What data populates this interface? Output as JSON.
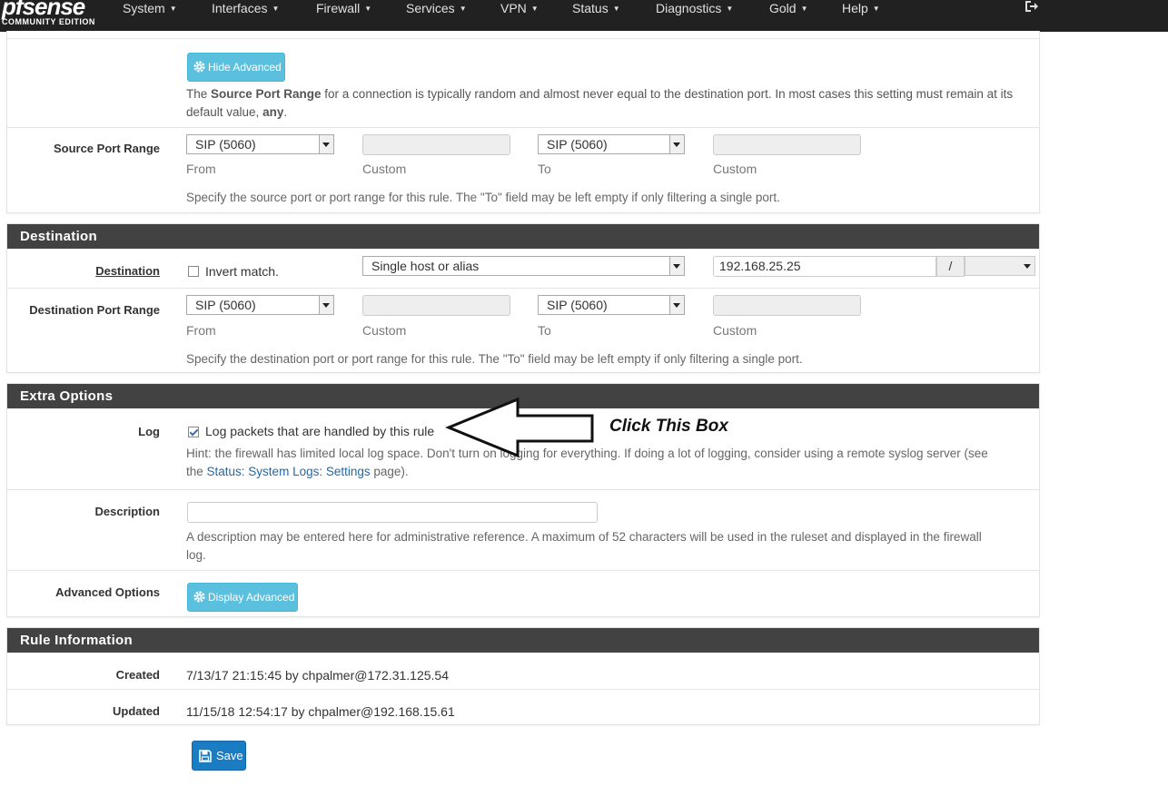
{
  "app": {
    "brand": "pfsense",
    "edition": "COMMUNITY EDITION"
  },
  "nav": {
    "items": [
      "System",
      "Interfaces",
      "Firewall",
      "Services",
      "VPN",
      "Status",
      "Diagnostics",
      "Gold",
      "Help"
    ]
  },
  "source": {
    "hide_advanced_label": "Hide Advanced",
    "help_prefix": "The ",
    "help_bold": "Source Port Range",
    "help_mid": " for a connection is typically random and almost never equal to the destination port. In most cases this setting must remain at its default value, ",
    "help_bold2": "any",
    "help_suffix": ".",
    "port_range_label": "Source Port Range",
    "from_value": "SIP (5060)",
    "to_value": "SIP (5060)",
    "from_label": "From",
    "custom_label": "Custom",
    "to_label": "To",
    "custom2_label": "Custom",
    "port_help": "Specify the source port or port range for this rule. The \"To\" field may be left empty if only filtering a single port."
  },
  "destination": {
    "heading": "Destination",
    "dest_label": "Destination",
    "invert_label": "Invert match.",
    "type_value": "Single host or alias",
    "address_value": "192.168.25.25",
    "slash": "/",
    "port_range_label": "Destination Port Range",
    "from_value": "SIP (5060)",
    "to_value": "SIP (5060)",
    "from_label": "From",
    "custom_label": "Custom",
    "to_label": "To",
    "custom2_label": "Custom",
    "port_help": "Specify the destination port or port range for this rule. The \"To\" field may be left empty if only filtering a single port."
  },
  "extra": {
    "heading": "Extra Options",
    "log_label": "Log",
    "log_checkbox_label": "Log packets that are handled by this rule",
    "log_checked": true,
    "log_hint_1": "Hint: the firewall has limited local log space. Don't turn on logging for everything. If doing a lot of logging, consider using a remote syslog server (see",
    "log_hint_2_prefix": "the ",
    "log_hint_link": "Status: System Logs: Settings",
    "log_hint_2_suffix": " page).",
    "description_label": "Description",
    "description_value": "",
    "description_help_1": "A description may be entered here for administrative reference. A maximum of 52 characters will be used in the ruleset and displayed in the firewall",
    "description_help_2": "log.",
    "advanced_label": "Advanced Options",
    "display_advanced_label": "Display Advanced"
  },
  "annotation": {
    "text": "Click This Box"
  },
  "rule_info": {
    "heading": "Rule Information",
    "created_label": "Created",
    "created_value": "7/13/17 21:15:45 by chpalmer@172.31.125.54",
    "updated_label": "Updated",
    "updated_value": "11/15/18 12:54:17 by chpalmer@192.168.15.61"
  },
  "actions": {
    "save_label": "Save"
  },
  "icons": {
    "gear": "gear-icon",
    "floppy": "floppy-icon",
    "logout": "logout-icon"
  }
}
